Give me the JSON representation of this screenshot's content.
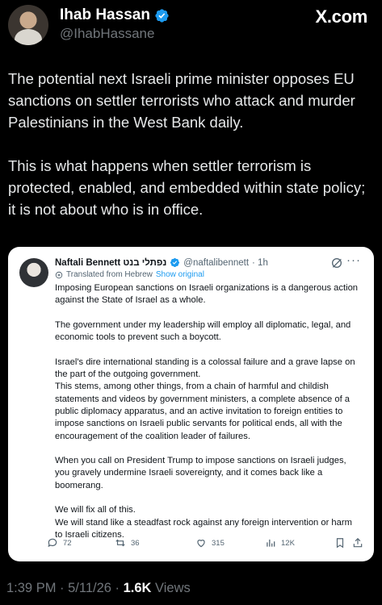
{
  "author": {
    "name": "Ihab Hassan",
    "handle": "@IhabHassane"
  },
  "site": "X.com",
  "post_paragraphs": [
    "The potential next Israeli prime minister opposes EU sanctions on settler terrorists who attack and murder Palestinians in the West Bank daily.",
    "This is what happens when settler terrorism is protected, enabled, and embedded within state policy; it is not about who is in office."
  ],
  "quoted": {
    "name": "Naftali Bennett נפתלי בנט",
    "handle": "@naftalibennett",
    "time": "· 1h",
    "more": "···",
    "translated_label": "Translated from Hebrew",
    "show_original": "Show original",
    "paragraphs": [
      "Imposing European sanctions on Israeli organizations is a dangerous action against the State of Israel as a whole.",
      "The government under my leadership will employ all diplomatic, legal, and economic tools to prevent such a boycott.",
      "Israel's dire international standing is a colossal failure and a grave lapse on the part of the outgoing government.",
      "This stems, among other things, from a chain of harmful and childish statements and videos by government ministers, a complete absence of a public diplomacy apparatus, and an active invitation to foreign entities to impose sanctions on Israeli public servants for political ends, all with the encouragement of the coalition leader of failures.",
      "When you call on President Trump to impose sanctions on Israeli judges, you gravely undermine Israeli sovereignty, and it comes back like a boomerang.",
      "We will fix all of this.",
      "We will stand like a steadfast rock against any foreign intervention or harm to Israeli citizens."
    ],
    "stats": {
      "replies": "72",
      "reposts": "36",
      "likes": "315",
      "views": "12K"
    }
  },
  "footer": {
    "time_date": "1:39 PM · 5/11/26 · ",
    "views_count": "1.6K",
    "views_label": " Views"
  },
  "colors": {
    "background": "#000000",
    "accent": "#1d9bf0",
    "muted": "#71767b"
  }
}
